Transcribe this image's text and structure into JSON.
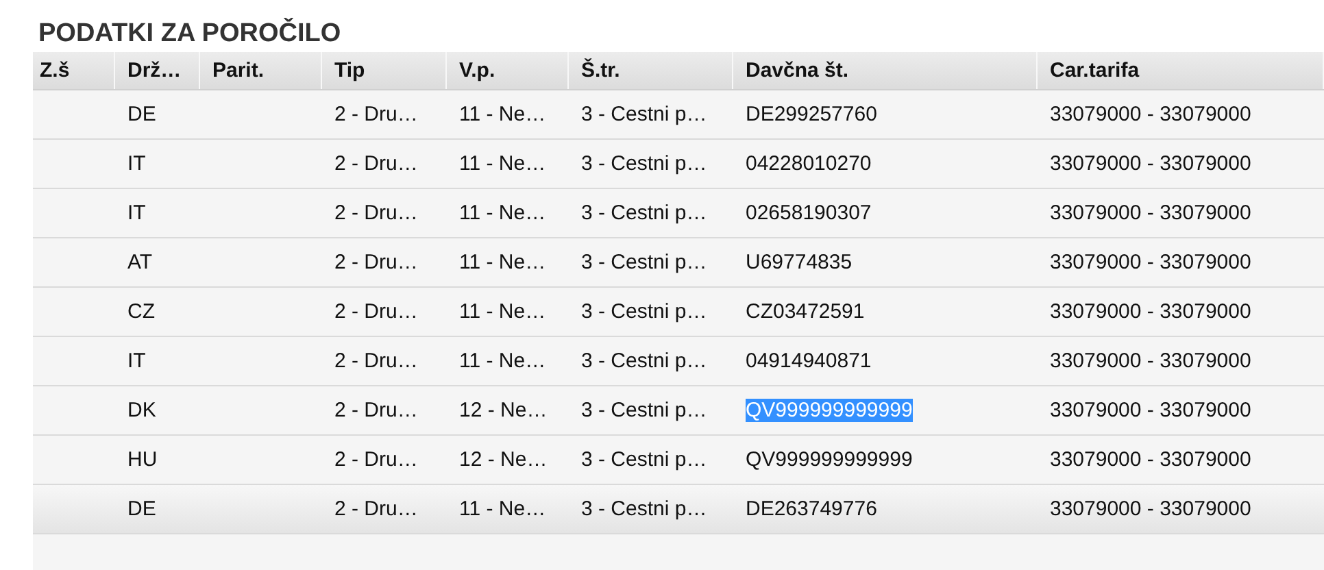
{
  "title": "PODATKI ZA POROČILO",
  "table": {
    "columns": [
      "Z.š",
      "Drž…",
      "Parit.",
      "Tip",
      "V.p.",
      "Š.tr.",
      "Davčna št.",
      "Car.tarifa"
    ],
    "rows": [
      {
        "cells": [
          "",
          "DE",
          "",
          "2 - Dru…",
          "11 - Ne…",
          "3 - Cestni p…",
          "DE299257760",
          "33079000 - 33079000"
        ],
        "hovered": false,
        "text_selected": false
      },
      {
        "cells": [
          "",
          "IT",
          "",
          "2 - Dru…",
          "11 - Ne…",
          "3 - Cestni p…",
          "04228010270",
          "33079000 - 33079000"
        ],
        "hovered": false,
        "text_selected": false
      },
      {
        "cells": [
          "",
          "IT",
          "",
          "2 - Dru…",
          "11 - Ne…",
          "3 - Cestni p…",
          "02658190307",
          "33079000 - 33079000"
        ],
        "hovered": false,
        "text_selected": false
      },
      {
        "cells": [
          "",
          "AT",
          "",
          "2 - Dru…",
          "11 - Ne…",
          "3 - Cestni p…",
          "U69774835",
          "33079000 - 33079000"
        ],
        "hovered": false,
        "text_selected": false
      },
      {
        "cells": [
          "",
          "CZ",
          "",
          "2 - Dru…",
          "11 - Ne…",
          "3 - Cestni p…",
          "CZ03472591",
          "33079000 - 33079000"
        ],
        "hovered": false,
        "text_selected": false
      },
      {
        "cells": [
          "",
          "IT",
          "",
          "2 - Dru…",
          "11 - Ne…",
          "3 - Cestni p…",
          "04914940871",
          "33079000 - 33079000"
        ],
        "hovered": false,
        "text_selected": false
      },
      {
        "cells": [
          "",
          "DK",
          "",
          "2 - Dru…",
          "12 - Ne…",
          "3 - Cestni p…",
          "QV999999999999",
          "33079000 - 33079000"
        ],
        "hovered": false,
        "text_selected": true
      },
      {
        "cells": [
          "",
          "HU",
          "",
          "2 - Dru…",
          "12 - Ne…",
          "3 - Cestni p…",
          "QV999999999999",
          "33079000 - 33079000"
        ],
        "hovered": false,
        "text_selected": false
      },
      {
        "cells": [
          "",
          "DE",
          "",
          "2 - Dru…",
          "11 - Ne…",
          "3 - Cestni p…",
          "DE263749776",
          "33079000 - 33079000"
        ],
        "hovered": true,
        "text_selected": false
      }
    ]
  }
}
